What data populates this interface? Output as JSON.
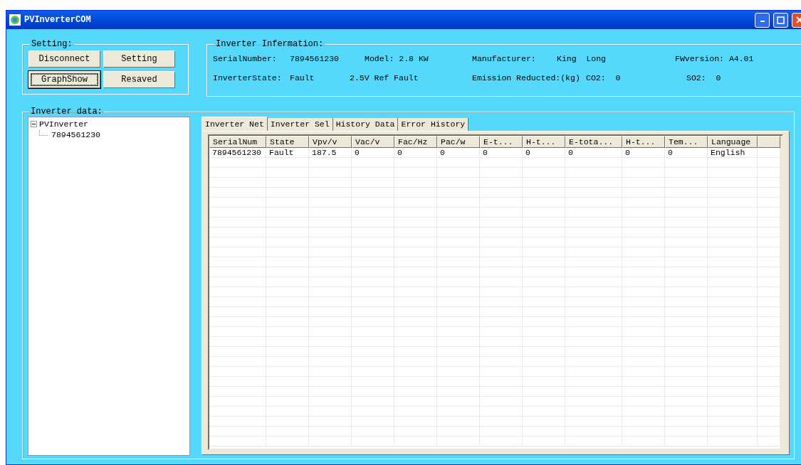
{
  "window": {
    "title": "PVInverterCOM"
  },
  "setting": {
    "title": "Setting:",
    "buttons": [
      {
        "label": "Disconnect",
        "focused": false
      },
      {
        "label": "Setting",
        "focused": false
      },
      {
        "label": "GraphShow",
        "focused": true
      },
      {
        "label": "Resaved",
        "focused": false
      }
    ]
  },
  "info": {
    "title": "Inverter Infermation:",
    "rows": [
      [
        "SerialNumber:",
        "7894561230",
        "Model: 2.8 KW",
        "Manufacturer:",
        "King  Long",
        "FWversion: A4.01"
      ],
      [
        "InverterState:",
        "Fault",
        "2.5V Ref Fault",
        "Emission Reducted:(kg)",
        "CO2:  0",
        "SO2:  0"
      ]
    ]
  },
  "data": {
    "title": "Inverter data:",
    "tree": [
      {
        "label": "PVInverter",
        "expanded": true,
        "children": [
          {
            "label": "7894561230"
          }
        ]
      }
    ],
    "tabs": [
      {
        "label": "Inverter Net",
        "selected": true
      },
      {
        "label": "Inverter Sel",
        "selected": false
      },
      {
        "label": "History Data",
        "selected": false
      },
      {
        "label": "Error History",
        "selected": false
      }
    ],
    "table": {
      "columns": [
        "SerialNum",
        "State",
        "Vpv/v",
        "Vac/v",
        "Fac/Hz",
        "Pac/w",
        "E-t...",
        "H-t...",
        "E-tota...",
        "H-t...",
        "Tem...",
        "Language"
      ],
      "rows": [
        [
          "7894561230",
          "Fault",
          "187.5",
          "0",
          "0",
          "0",
          "0",
          "0",
          "0",
          "0",
          "0",
          "English"
        ]
      ]
    }
  }
}
